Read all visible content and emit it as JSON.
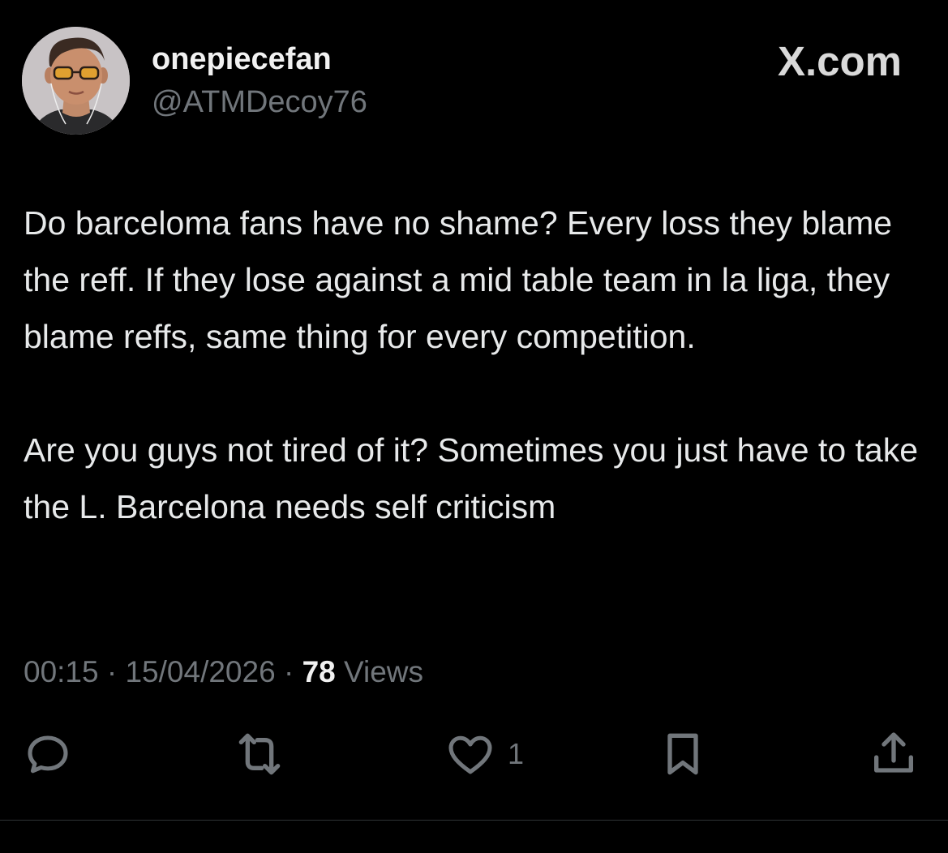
{
  "header": {
    "display_name": "onepiecefan",
    "handle": "@ATMDecoy76",
    "brand": "X.com"
  },
  "tweet": {
    "text": "Do barceloma fans have no shame? Every loss they blame the reff. If they lose against a mid table team in la liga, they blame reffs, same thing for every competition.\n\nAre you guys not tired of it? Sometimes you just have to take the L. Barcelona needs self criticism"
  },
  "meta": {
    "time": "00:15",
    "separator": "·",
    "date": "15/04/2026",
    "views_count": "78",
    "views_label": "Views"
  },
  "actions": {
    "reply_icon": "reply-icon",
    "repost_icon": "repost-icon",
    "like_icon": "like-icon",
    "like_count": "1",
    "bookmark_icon": "bookmark-icon",
    "share_icon": "share-icon"
  },
  "colors": {
    "background": "#000000",
    "text_primary": "#e7e9ea",
    "text_secondary": "#71767b",
    "divider": "#2f3336"
  }
}
